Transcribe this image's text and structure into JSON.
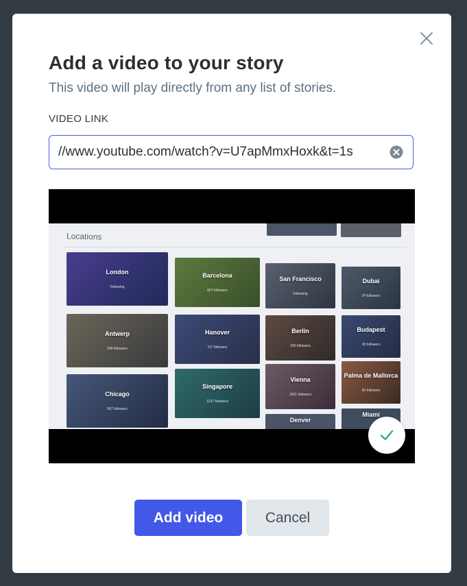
{
  "modal": {
    "title": "Add a video to your story",
    "subtitle": "This video will play directly from any list of stories.",
    "field_label": "VIDEO LINK",
    "video_link_value": "//www.youtube.com/watch?v=U7apMmxHoxk&t=1s",
    "actions": {
      "add_label": "Add video",
      "cancel_label": "Cancel"
    },
    "icons": {
      "close": "close-icon",
      "clear": "clear-circle-icon",
      "check": "checkmark-icon"
    }
  },
  "preview": {
    "section_title": "Locations",
    "tiles": [
      {
        "city": "London",
        "meta": "Following"
      },
      {
        "city": "Barcelona",
        "meta": "657 followers"
      },
      {
        "city": "San Francisco",
        "meta": "Following"
      },
      {
        "city": "Dubai",
        "meta": "24 followers"
      },
      {
        "city": "Antwerp",
        "meta": "296 followers"
      },
      {
        "city": "Hanover",
        "meta": "117 followers"
      },
      {
        "city": "Berlin",
        "meta": "296 followers"
      },
      {
        "city": "Budapest",
        "meta": "28 followers"
      },
      {
        "city": "Chicago",
        "meta": "567 followers"
      },
      {
        "city": "Singapore",
        "meta": "1237 followers"
      },
      {
        "city": "Vienna",
        "meta": "1001 followers"
      },
      {
        "city": "Palma de Mallorca",
        "meta": "66 followers"
      },
      {
        "city": "Denver",
        "meta": ""
      },
      {
        "city": "Miami",
        "meta": ""
      }
    ]
  },
  "colors": {
    "backdrop": "#323b42",
    "primary": "#4258e8",
    "secondary": "#e1e6ea",
    "success": "#3cb371"
  }
}
